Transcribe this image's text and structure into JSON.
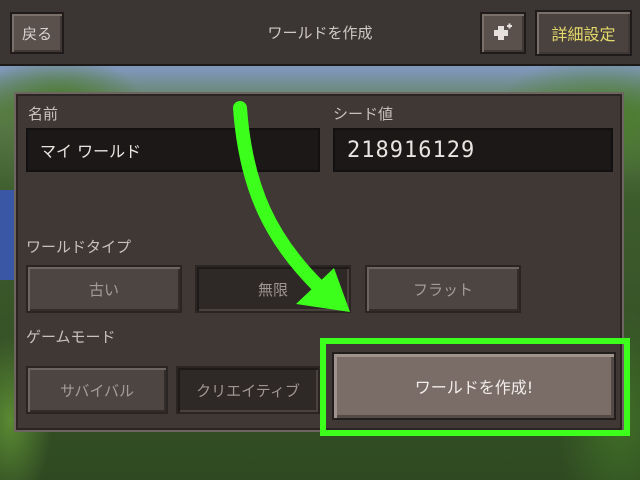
{
  "topbar": {
    "back_label": "戻る",
    "title": "ワールドを作成",
    "add_icon": "puzzle-plus-icon",
    "advanced_label": "詳細設定"
  },
  "form": {
    "name_label": "名前",
    "name_value": "マイ ワールド",
    "seed_label": "シード値",
    "seed_value": "218916129",
    "world_type_label": "ワールドタイプ",
    "world_types": [
      "古い",
      "無限",
      "フラット"
    ],
    "world_type_selected": "無限",
    "game_mode_label": "ゲームモード",
    "game_modes": [
      "サバイバル",
      "クリエイティブ"
    ],
    "game_mode_selected": "クリエイティブ",
    "create_label": "ワールドを作成!"
  },
  "annotation": {
    "arrow_color": "#3cff1c",
    "highlight_color": "#3cff1c"
  }
}
